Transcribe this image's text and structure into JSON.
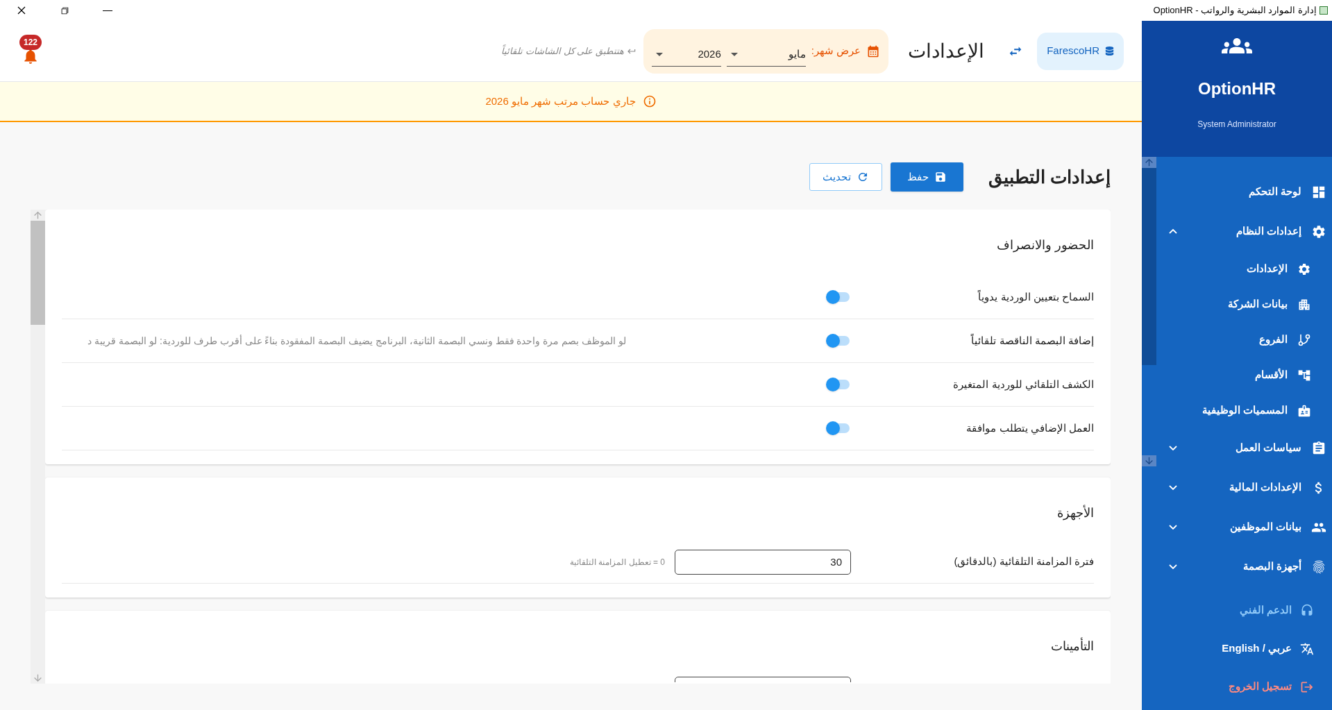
{
  "window": {
    "title": "OptionHR - إدارة الموارد البشرية والرواتب"
  },
  "header": {
    "notifications": "122",
    "hint": "هتتطبق على كل الشاشات تلقائياً",
    "month_picker": {
      "label": "عرض شهر:",
      "month": "مايو",
      "year": "2026"
    },
    "title": "الإعدادات",
    "company": "FarescoHR"
  },
  "banner": {
    "text": "جاري حساب مرتب شهر مايو 2026"
  },
  "page": {
    "title": "إعدادات التطبيق",
    "buttons": [
      {
        "kind": "primary",
        "label": "حفظ"
      },
      {
        "kind": "outline",
        "label": "تحديث"
      }
    ]
  },
  "sections": [
    {
      "title": "الحضور والانصراف",
      "rows": [
        {
          "kind": "toggle",
          "label": "السماح بتعيين الوردية يدوياً",
          "on": true
        },
        {
          "kind": "toggle",
          "label": "إضافة البصمة الناقصة تلقائياً",
          "on": true,
          "hint": "لو الموظف بصم مرة واحدة فقط ونسي البصمة الثانية، البرنامج يضيف البصمة المفقودة بناءً على أقرب طرف للوردية: لو البصمة قريبة د"
        },
        {
          "kind": "toggle",
          "label": "الكشف التلقائي للوردية المتغيرة",
          "on": true
        },
        {
          "kind": "toggle",
          "label": "العمل الإضافي يتطلب موافقة",
          "on": true
        }
      ]
    },
    {
      "title": "الأجهزة",
      "rows": [
        {
          "kind": "number",
          "label": "فترة المزامنة التلقائية (بالدقائق)",
          "value": "30",
          "hint": "0 = تعطيل المزامنة التلقائية"
        }
      ]
    },
    {
      "title": "التأمينات",
      "rows": [
        {
          "kind": "clipped"
        }
      ]
    }
  ],
  "sidebar": {
    "brand": "OptionHR",
    "role": "System Administrator",
    "items": [
      {
        "label": "لوحة التحكم"
      },
      {
        "label": "إعدادات النظام",
        "expanded": true,
        "children": [
          {
            "label": "الإعدادات"
          },
          {
            "label": "بيانات الشركة"
          },
          {
            "label": "الفروع"
          },
          {
            "label": "الأقسام"
          },
          {
            "label": "المسميات الوظيفية"
          }
        ]
      },
      {
        "label": "سياسات العمل",
        "expanded": false
      },
      {
        "label": "الإعدادات المالية",
        "expanded": false
      },
      {
        "label": "بيانات الموظفين",
        "expanded": false
      },
      {
        "label": "أجهزة البصمة",
        "expanded": false
      }
    ],
    "footer": [
      {
        "kind": "support",
        "label": "الدعم الفني"
      },
      {
        "kind": "language",
        "label": "عربي / English"
      },
      {
        "kind": "logout",
        "label": "تسجيل الخروج"
      }
    ]
  }
}
